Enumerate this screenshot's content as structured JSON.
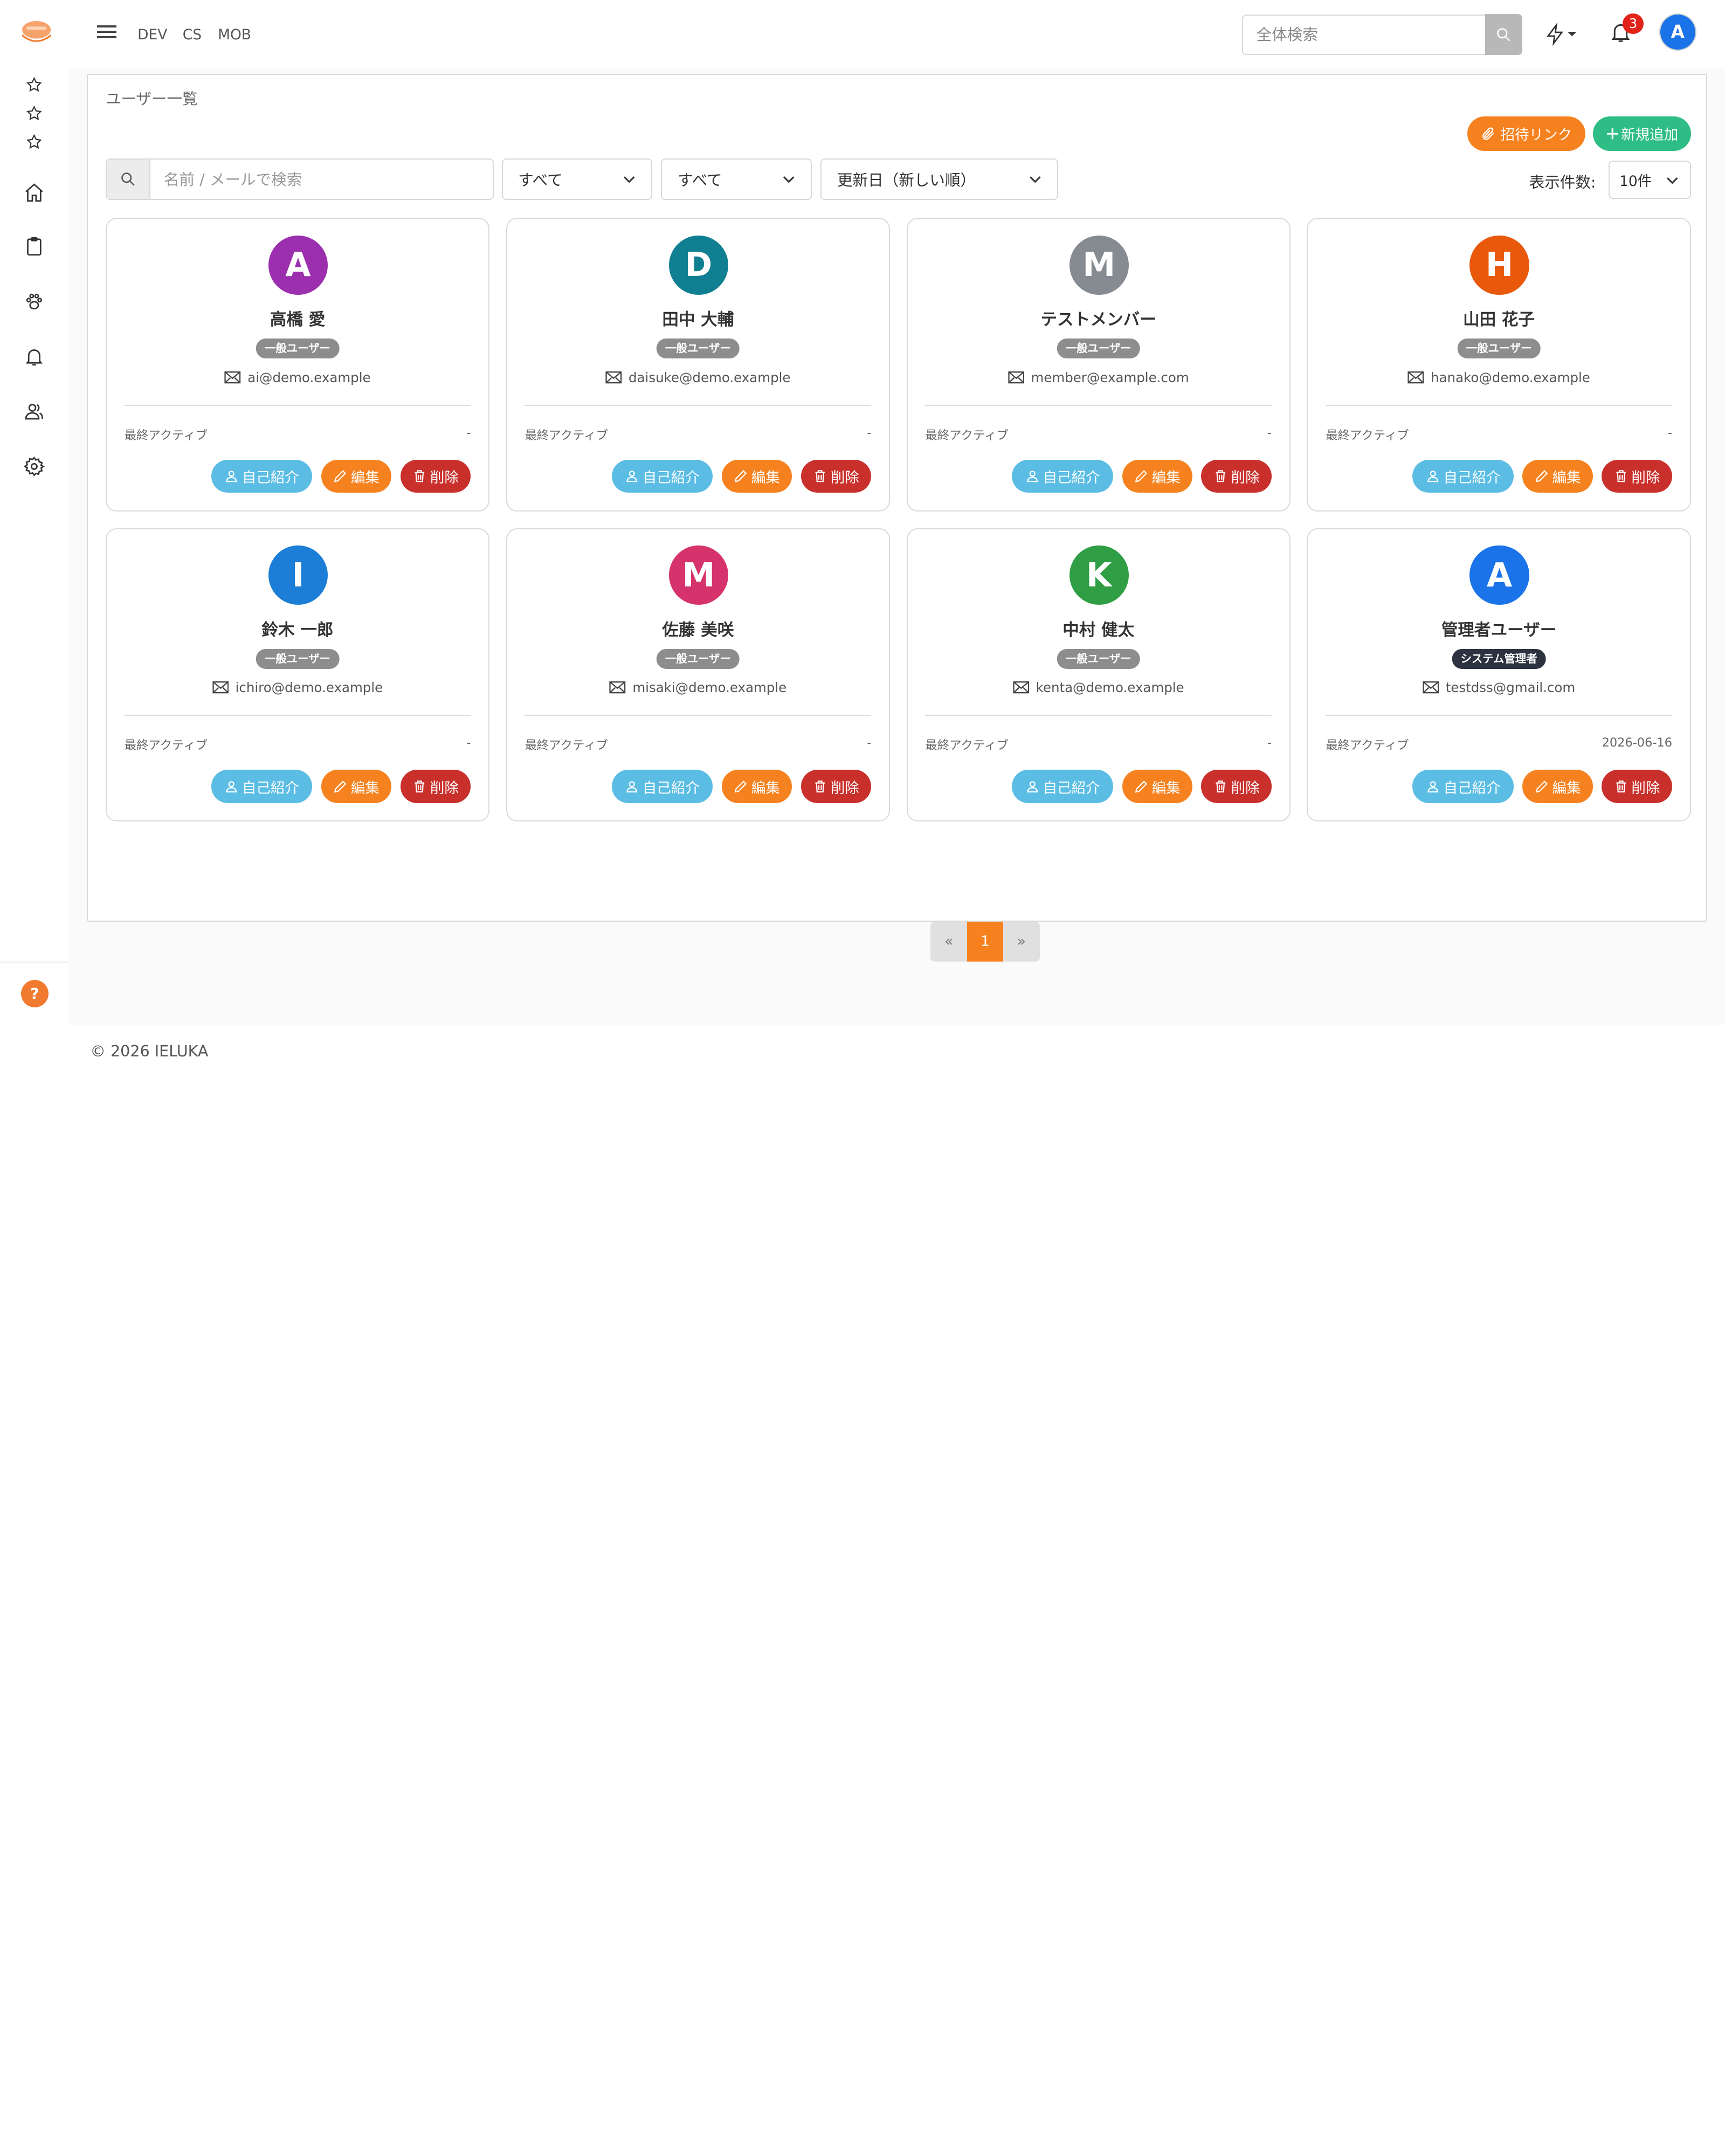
{
  "topbar": {
    "links": [
      "DEV",
      "CS",
      "MOB"
    ],
    "search_placeholder": "全体検索",
    "notification_count": "3",
    "avatar_letter": "A"
  },
  "page": {
    "title": "ユーザー一覧",
    "invite_label": "招待リンク",
    "new_label": "新規追加"
  },
  "filters": {
    "search_placeholder": "名前 / メールで検索",
    "select1": "すべて",
    "select2": "すべて",
    "sort": "更新日（新しい順）",
    "per_page_label": "表示件数:",
    "per_page": "10件"
  },
  "card_labels": {
    "last_active": "最終アクティブ",
    "intro": "自己紹介",
    "edit": "編集",
    "delete": "削除"
  },
  "users": [
    {
      "letter": "A",
      "name": "高橋 愛",
      "role": "一般ユーザー",
      "email": "ai@demo.example",
      "last_active": "-",
      "color": "#9b2fae"
    },
    {
      "letter": "D",
      "name": "田中 大輔",
      "role": "一般ユーザー",
      "email": "daisuke@demo.example",
      "last_active": "-",
      "color": "#0f7f91"
    },
    {
      "letter": "M",
      "name": "テストメンバー",
      "role": "一般ユーザー",
      "email": "member@example.com",
      "last_active": "-",
      "color": "#868b91"
    },
    {
      "letter": "H",
      "name": "山田 花子",
      "role": "一般ユーザー",
      "email": "hanako@demo.example",
      "last_active": "-",
      "color": "#e8590c"
    },
    {
      "letter": "I",
      "name": "鈴木 一郎",
      "role": "一般ユーザー",
      "email": "ichiro@demo.example",
      "last_active": "-",
      "color": "#1c7ed6"
    },
    {
      "letter": "M",
      "name": "佐藤 美咲",
      "role": "一般ユーザー",
      "email": "misaki@demo.example",
      "last_active": "-",
      "color": "#d6336c"
    },
    {
      "letter": "K",
      "name": "中村 健太",
      "role": "一般ユーザー",
      "email": "kenta@demo.example",
      "last_active": "-",
      "color": "#2f9e44"
    },
    {
      "letter": "A",
      "name": "管理者ユーザー",
      "role": "システム管理者",
      "email": "testdss@gmail.com",
      "last_active": "2026-06-16",
      "color": "#1a73e8",
      "admin": true
    }
  ],
  "pagination": {
    "prev": "«",
    "current": "1",
    "next": "»"
  },
  "footer": "© 2026 IELUKA",
  "help": "?"
}
